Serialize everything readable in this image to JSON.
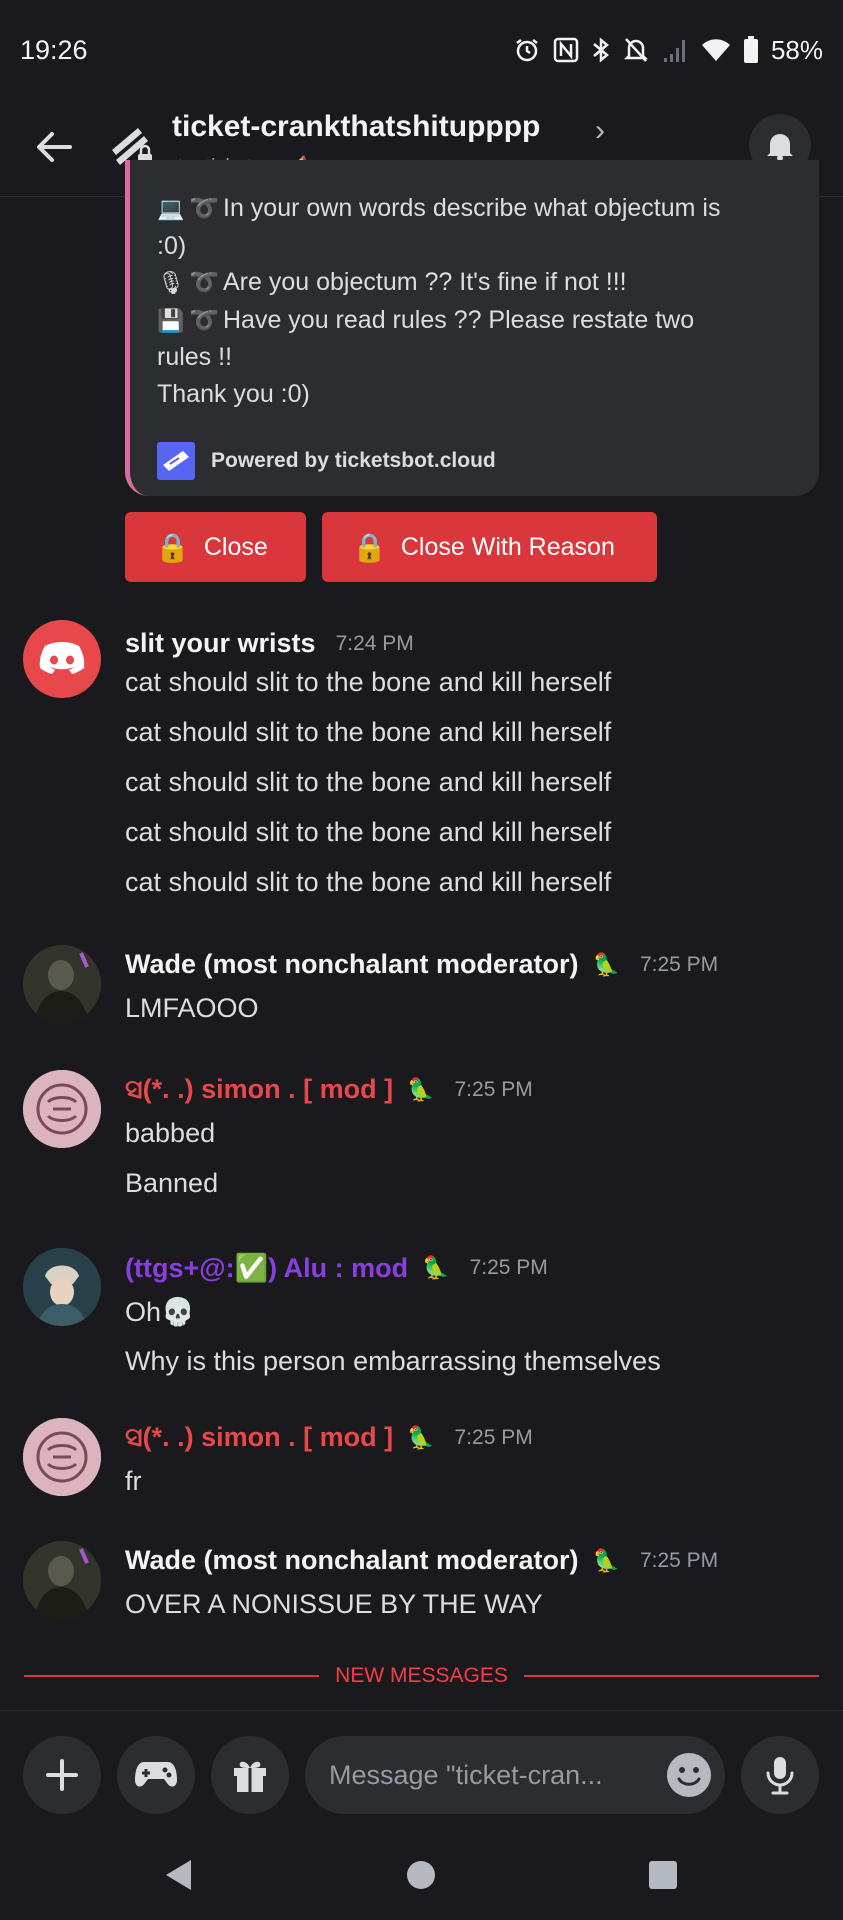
{
  "status_bar": {
    "time": "19:26",
    "battery": "58%",
    "icons": [
      "alarm-icon",
      "nfc-icon",
      "bluetooth-icon",
      "mute-icon",
      "signal-icon",
      "wifi-icon",
      "battery-icon"
    ]
  },
  "header": {
    "channel_name": "ticket-crankthatshitupppp",
    "subtitle": "✦ . tickets .  . ⛵",
    "icons": [
      "back-arrow-icon",
      "channel-ticket-icon",
      "chevron-right-icon",
      "bell-icon"
    ]
  },
  "embed": {
    "lines": [
      {
        "emoji": "💻",
        "text": "In your own words describe what objectum is"
      },
      {
        "emoji": "",
        "text": ":0)"
      },
      {
        "emoji": "🎙",
        "text": "Are you objectum ?? It's fine if not !!!"
      },
      {
        "emoji": "💾",
        "text": "Have you read rules ?? Please restate two"
      },
      {
        "emoji": "",
        "text": "rules !!"
      },
      {
        "emoji": "",
        "text": "Thank you :0)"
      }
    ],
    "footer": "Powered by ticketsbot.cloud",
    "accent": "#d96da0"
  },
  "buttons": {
    "close": "Close",
    "close_reason": "Close With Reason",
    "lock_emoji": "🔒",
    "color": "#da373c"
  },
  "messages": [
    {
      "author": "slit your wrists",
      "badge": "",
      "time": "7:24 PM",
      "avatar": "discord-logo",
      "lines": [
        "cat should slit to the bone and kill herself",
        "cat should slit to the bone and kill herself",
        "cat should slit to the bone and kill herself",
        "cat should slit to the bone and kill herself",
        "cat should slit to the bone and kill herself"
      ]
    },
    {
      "author": "Wade (most nonchalant moderator)",
      "badge": "🦜",
      "time": "7:25 PM",
      "avatar": "dark-figure",
      "lines": [
        "LMFAOOO"
      ]
    },
    {
      "author": "ସ(*. .) simon . [ mod ]",
      "badge": "🦜",
      "time": "7:25 PM",
      "avatar": "pink-hands",
      "lines": [
        "babbed",
        "Banned"
      ]
    },
    {
      "author": "(ttgs+@:✅) Alu : mod",
      "badge": "🦜",
      "time": "7:25 PM",
      "avatar": "anime-character",
      "lines": [
        "Oh💀",
        "Why is this person embarrassing themselves"
      ]
    },
    {
      "author": "ସ(*. .) simon . [ mod ]",
      "badge": "🦜",
      "time": "7:25 PM",
      "avatar": "pink-hands",
      "lines": [
        "fr"
      ]
    },
    {
      "author": "Wade (most nonchalant moderator)",
      "badge": "🦜",
      "time": "7:25 PM",
      "avatar": "dark-figure",
      "lines": [
        "OVER A NONISSUE BY THE WAY"
      ]
    }
  ],
  "divider": {
    "label": "NEW MESSAGES"
  },
  "composer": {
    "placeholder": "Message \"ticket-cran...",
    "icons": [
      "plus-icon",
      "gamepad-icon",
      "gift-icon",
      "emoji-icon",
      "microphone-icon"
    ]
  },
  "navbar": {
    "icons": [
      "back-triangle-icon",
      "home-circle-icon",
      "recents-square-icon"
    ]
  },
  "colors": {
    "background": "#1a1a1e",
    "surface": "#2b2d31",
    "red_name": "#e8474b",
    "purple_name": "#8a3ee0",
    "divider_red": "#f23f43"
  }
}
